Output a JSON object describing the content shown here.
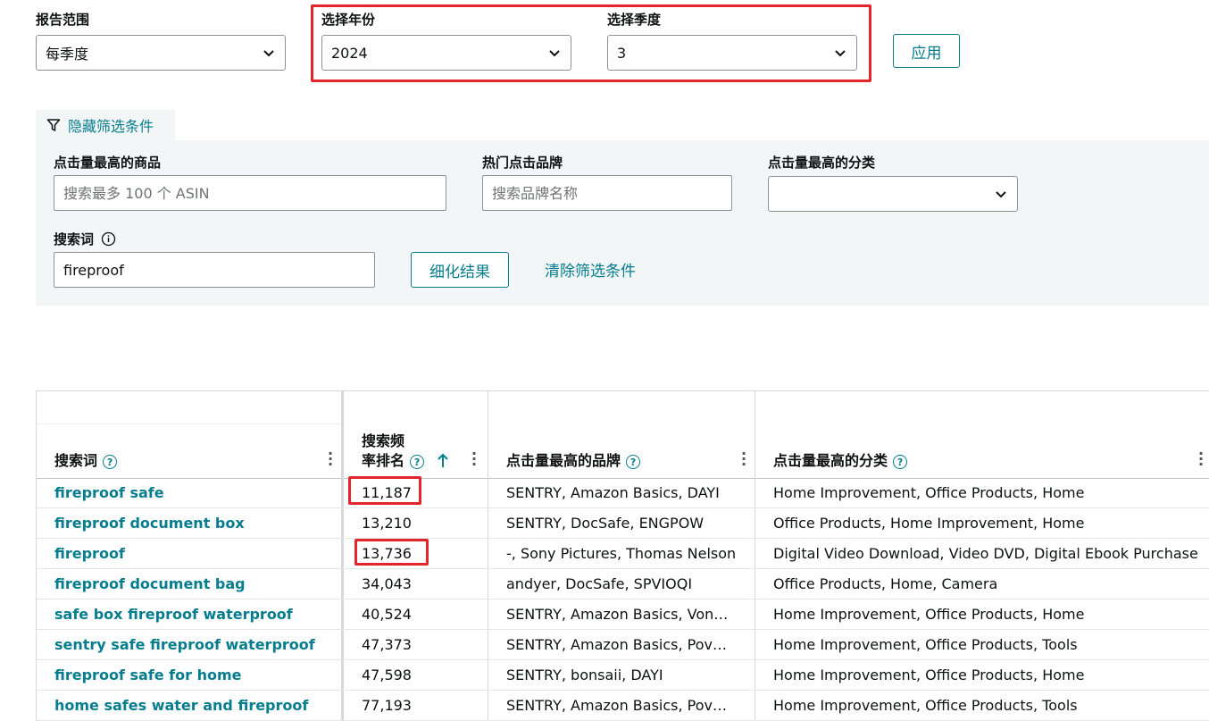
{
  "report_range": {
    "label": "报告范围",
    "value": "每季度"
  },
  "year": {
    "label": "选择年份",
    "value": "2024"
  },
  "quarter": {
    "label": "选择季度",
    "value": "3"
  },
  "apply_label": "应用",
  "filters_toggle_label": "隐藏筛选条件",
  "filters": {
    "top_product": {
      "label": "点击量最高的商品",
      "placeholder": "搜索最多 100 个 ASIN"
    },
    "top_brand": {
      "label": "热门点击品牌",
      "placeholder": "搜索品牌名称"
    },
    "top_category": {
      "label": "点击量最高的分类",
      "value": ""
    },
    "search_term": {
      "label": "搜索词",
      "value": "fireproof"
    },
    "refine_label": "细化结果",
    "clear_label": "清除筛选条件"
  },
  "table": {
    "headers": {
      "term": "搜索词",
      "rank_line1": "搜索频",
      "rank_line2": "率排名",
      "brand": "点击量最高的品牌",
      "category": "点击量最高的分类"
    },
    "rows": [
      {
        "term": "fireproof safe",
        "rank": "11,187",
        "brand": "SENTRY, Amazon Basics, DAYI",
        "category": "Home Improvement, Office Products, Home"
      },
      {
        "term": "fireproof document box",
        "rank": "13,210",
        "brand": "SENTRY, DocSafe, ENGPOW",
        "category": "Office Products, Home Improvement, Home"
      },
      {
        "term": "fireproof",
        "rank": "13,736",
        "brand": "-, Sony Pictures, Thomas Nelson",
        "category": "Digital Video Download, Video DVD, Digital Ebook Purchase"
      },
      {
        "term": "fireproof document bag",
        "rank": "34,043",
        "brand": "andyer, DocSafe, SPVIOQI",
        "category": "Office Products, Home, Camera"
      },
      {
        "term": "safe box fireproof waterproof",
        "rank": "40,524",
        "brand": "SENTRY, Amazon Basics, Von…",
        "category": "Home Improvement, Office Products, Home"
      },
      {
        "term": "sentry safe fireproof waterproof",
        "rank": "47,373",
        "brand": "SENTRY, Amazon Basics, Pov…",
        "category": "Home Improvement, Office Products, Tools"
      },
      {
        "term": "fireproof safe for home",
        "rank": "47,598",
        "brand": "SENTRY, bonsaii, DAYI",
        "category": "Home Improvement, Office Products, Home"
      },
      {
        "term": "home safes water and fireproof",
        "rank": "77,193",
        "brand": "SENTRY, Amazon Basics, Pov…",
        "category": "Home Improvement, Office Products, Tools"
      }
    ]
  },
  "colors": {
    "accent": "#067d8e",
    "highlight": "#e3262b",
    "panel": "#f2f6f6"
  }
}
